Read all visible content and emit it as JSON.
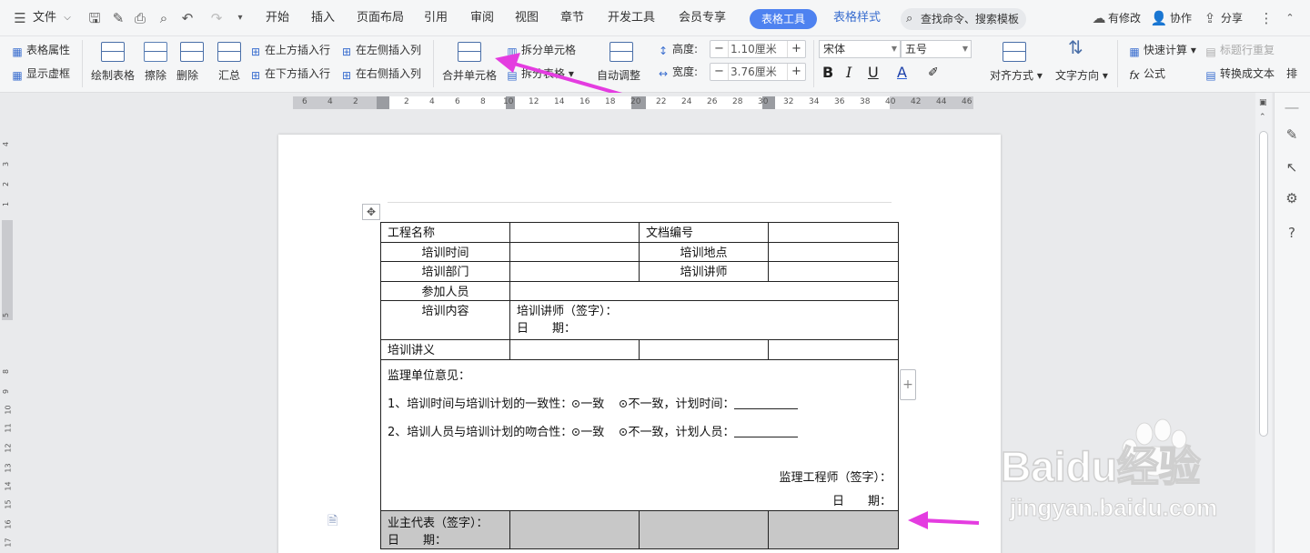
{
  "menu": {
    "file_label": "文件",
    "tabs": [
      "开始",
      "插入",
      "页面布局",
      "引用",
      "审阅",
      "视图",
      "章节",
      "开发工具",
      "会员专享"
    ],
    "active_tab": "表格工具",
    "style_tab": "表格样式",
    "search_placeholder": "查找命令、搜索模板",
    "has_changes": "有修改",
    "collab": "协作",
    "share": "分享"
  },
  "ribbon": {
    "table_props": "表格属性",
    "show_grid": "显示虚框",
    "draw_table": "绘制表格",
    "erase": "擦除",
    "delete": "删除",
    "summary": "汇总",
    "insert_above": "在上方插入行",
    "insert_below": "在下方插入行",
    "insert_left": "在左侧插入列",
    "insert_right": "在右侧插入列",
    "merge_cells": "合并单元格",
    "split_cells": "拆分单元格",
    "split_table": "拆分表格",
    "auto_fit": "自动调整",
    "height_label": "高度:",
    "height_value": "1.10厘米",
    "width_label": "宽度:",
    "width_value": "3.76厘米",
    "font_name": "宋体",
    "font_size": "五号",
    "align": "对齐方式",
    "text_dir": "文字方向",
    "quick_calc": "快速计算",
    "header_repeat": "标题行重复",
    "formula": "公式",
    "to_text": "转换成文本",
    "more": "排"
  },
  "ruler": {
    "h_ticks": [
      "6",
      "4",
      "2",
      "2",
      "4",
      "6",
      "8",
      "10",
      "12",
      "14",
      "16",
      "18",
      "20",
      "22",
      "24",
      "26",
      "28",
      "30",
      "32",
      "34",
      "36",
      "38",
      "40",
      "42",
      "44",
      "46"
    ],
    "v_ticks": [
      "4",
      "3",
      "2",
      "1",
      "5",
      "8",
      "9",
      "10",
      "11",
      "12",
      "13",
      "14",
      "15",
      "16",
      "17"
    ]
  },
  "table": {
    "r1": {
      "c1": "工程名称",
      "c3": "文档编号"
    },
    "r2": {
      "c1": "培训时间",
      "c3": "培训地点"
    },
    "r3": {
      "c1": "培训部门",
      "c3": "培训讲师"
    },
    "r4": {
      "c1": "参加人员"
    },
    "r5": {
      "c1": "培训内容",
      "sign": "培训讲师（签字）：",
      "date": "日　　期："
    },
    "r6": {
      "c1": "培训讲义"
    },
    "r7": {
      "title": "监理单位意见：",
      "line1_prefix": "1、培训时间与培训计划的一致性：",
      "opt_a": "一致",
      "line1_opt_b": "不一致，计划时间：",
      "line2_prefix": "2、培训人员与培训计划的吻合性：",
      "line2_opt_b": "不一致，计划人员：",
      "engineer_sign": "监理工程师（签字）：",
      "engineer_date": "日　　期："
    },
    "r8": {
      "sign": "业主代表（签字）：",
      "date": "日　　期："
    }
  },
  "watermark": {
    "brand": "Baidu经验",
    "url": "jingyan.baidu.com"
  },
  "colors": {
    "accent": "#4e82f0",
    "arrow": "#e43ce0"
  }
}
